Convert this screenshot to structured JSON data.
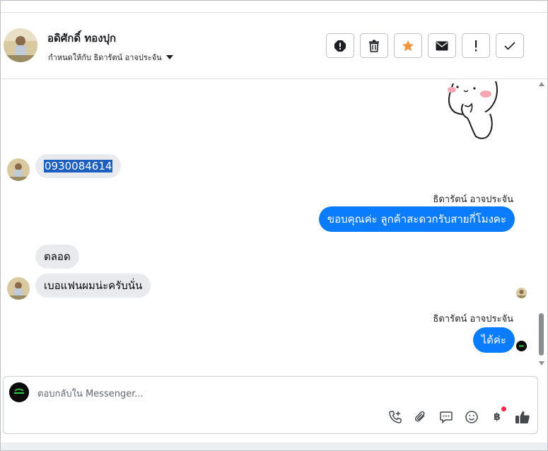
{
  "header": {
    "contact_name": "อดิศักดิ์ ทองปุก",
    "assigned_to": "กำหนดให้กับ ธิดารัตน์ อาจประจัน",
    "actions": [
      "spam-icon",
      "trash-icon",
      "star-icon",
      "mail-icon",
      "exclamation-icon",
      "check-icon"
    ]
  },
  "messages": {
    "incoming_phone": "0930084614",
    "outgoing_1": {
      "sender": "ธิดารัตน์ อาจประจัน",
      "text": "ขอบคุณค่ะ ลูกค้าสะดวกรับสายกี่โมงคะ"
    },
    "incoming_2": "ตลอด",
    "incoming_3": "เบอแฟนผมน่ะครับนั่น",
    "outgoing_2": {
      "sender": "ธิดารัตน์ อาจประจัน",
      "text": "ได้ค่ะ"
    }
  },
  "composer": {
    "placeholder": "ตอบกลับใน Messenger...",
    "tools": [
      "phone-add-icon",
      "paperclip-icon",
      "saved-reply-icon",
      "emoji-icon",
      "baht-icon",
      "like-icon"
    ],
    "baht_symbol": "฿"
  },
  "colors": {
    "outgoing_bubble": "#0a7cff",
    "incoming_bubble": "#e9eaed",
    "notification_dot": "#f02849",
    "star": "#f7923b"
  }
}
